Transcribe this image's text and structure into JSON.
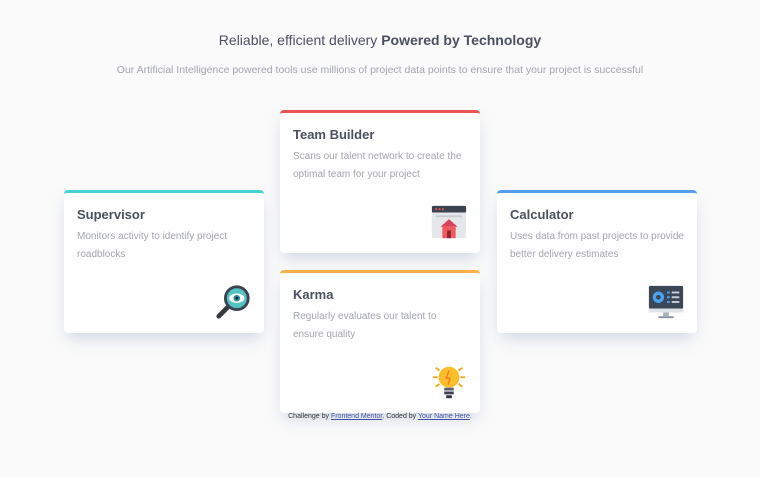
{
  "header": {
    "title_light": "Reliable, efficient delivery",
    "title_bold": "Powered by Technology",
    "subtitle": "Our Artificial Intelligence powered tools use millions of project data points to ensure that your project is successful"
  },
  "cards": [
    {
      "title": "Supervisor",
      "text": "Monitors activity to identify project roadblocks",
      "accent": "#44d3d2",
      "icon": "magnifier-eye-icon"
    },
    {
      "title": "Team Builder",
      "text": "Scans our talent network to create the optimal team for your project",
      "accent": "#ea5454",
      "icon": "browser-home-icon"
    },
    {
      "title": "Karma",
      "text": "Regularly evaluates our talent to ensure quality",
      "accent": "#fcaf4a",
      "icon": "lightbulb-icon"
    },
    {
      "title": "Calculator",
      "text": "Uses data from past projects to provide better delivery estimates",
      "accent": "#549ef2",
      "icon": "monitor-chart-icon"
    }
  ],
  "attribution": {
    "prefix": "Challenge by",
    "link1": "Frontend Mentor",
    "middle": ". Coded by",
    "link2": "Your Name Here",
    "suffix": "."
  }
}
